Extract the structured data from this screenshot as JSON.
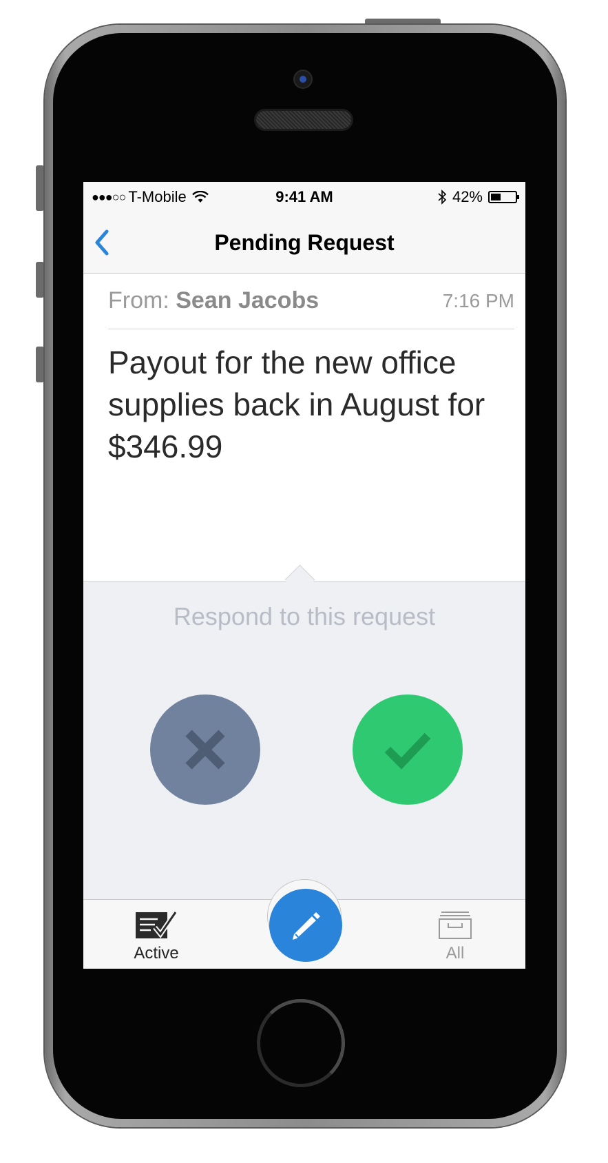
{
  "status_bar": {
    "signal": "●●●○○",
    "carrier": "T-Mobile",
    "time": "9:41 AM",
    "battery_percent_text": "42%",
    "battery_level": 0.42,
    "icons": [
      "wifi-icon",
      "bluetooth-icon",
      "battery-icon"
    ]
  },
  "nav": {
    "title": "Pending Request",
    "back_icon": "chevron-left-icon",
    "accent_color": "#2a84d9"
  },
  "message": {
    "from_label": "From:",
    "from_name": "Sean Jacobs",
    "time": "7:16 PM",
    "body": "Payout for the new office supplies back in August for $346.99"
  },
  "respond": {
    "title": "Respond to this request",
    "decline_icon": "close-icon",
    "decline_color": "#71829e",
    "approve_icon": "checkmark-icon",
    "approve_color": "#2fc971"
  },
  "tab_bar": {
    "tabs": [
      {
        "label": "Active",
        "icon": "checklist-icon",
        "selected": true
      },
      {
        "label": "All",
        "icon": "archive-box-icon",
        "selected": false
      }
    ],
    "compose_icon": "pencil-icon",
    "compose_color": "#2a84d9"
  }
}
